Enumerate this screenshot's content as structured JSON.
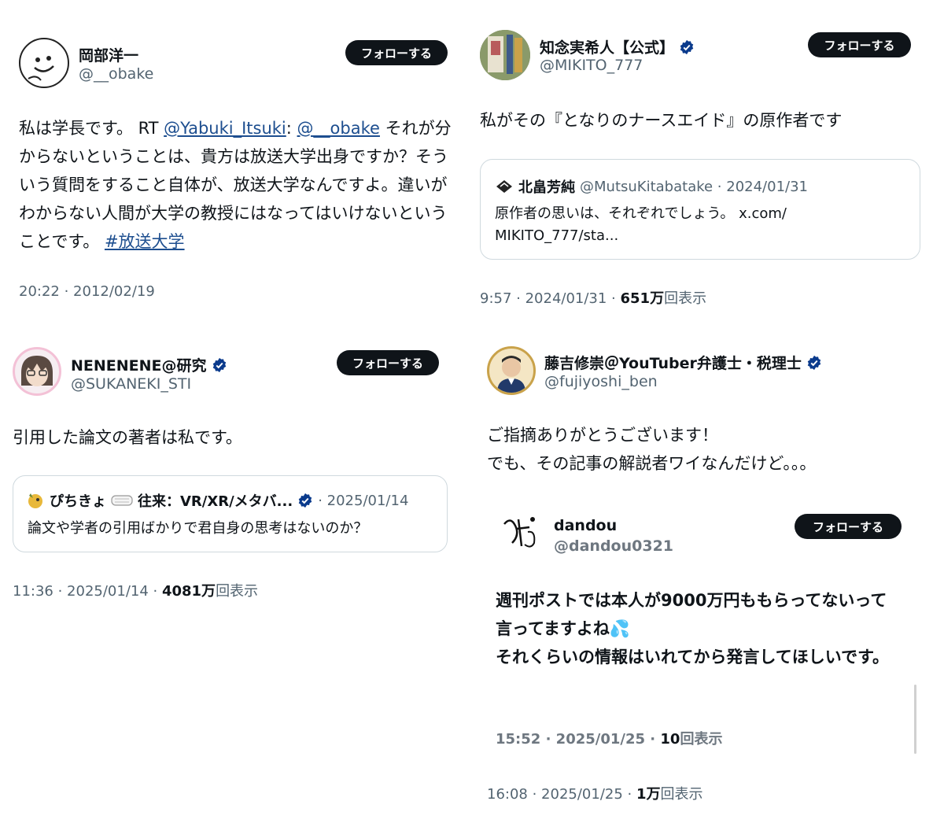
{
  "follow_label": "フォローする",
  "views_suffix": "回表示",
  "tweets": {
    "t1": {
      "name": "岡部洋一",
      "handle": "@__obake",
      "text_prefix": "私は学長です。 RT ",
      "mention1": "@Yabuki_Itsuki",
      "colon": ": ",
      "mention2": "@__obake",
      "text_main": " それが分からないということは、貴方は放送大学出身ですか？そういう質問をすること自体が、放送大学なんですよ。違いがわからない人間が大学の教授にはなってはいけないということです。 ",
      "hashtag": "#放送大学",
      "time": "20:22 · 2012/02/19"
    },
    "t2": {
      "name": "知念実希人【公式】",
      "handle": "@MIKITO_777",
      "text": "私がその『となりのナースエイド』の原作者です",
      "quote": {
        "name": "北畠芳純",
        "handle_date": "@MutsuKitabatake · 2024/01/31",
        "text": "原作者の思いは、それぞれでしょう。 x.com/\nMIKITO_777/sta..."
      },
      "time": "9:57 · 2024/01/31 · ",
      "views": "651万"
    },
    "t3": {
      "name": "NENENENE@研究",
      "handle": "@SUKANEKI_STI",
      "text": "引用した論文の著者は私です。",
      "quote": {
        "name": "ぴちきょ",
        "name2": "往来：VR/XR/メタバ...",
        "date": "· 2025/01/14",
        "text": "論文や学者の引用ばかりで君自身の思考はないのか？"
      },
      "time": "11:36 · 2025/01/14 · ",
      "views": "4081万"
    },
    "t4": {
      "name": "藤吉修崇＠YouTuber弁護士・税理士",
      "handle": "@fujiyoshi_ben",
      "text": "ご指摘ありがとうございます！\nでも、その記事の解説者ワイなんだけど。。。",
      "inner": {
        "name": "dandou",
        "handle": "@dandou0321",
        "text": "週刊ポストでは本人が9000万円ももらってないって言ってますよね💦\nそれくらいの情報はいれてから発言してほしいです。",
        "time": "15:52 · 2025/01/25 · ",
        "views": "10"
      },
      "time": "16:08 · 2025/01/25 · ",
      "views": "1万"
    }
  },
  "colors": {
    "verified": "#0a3a8c",
    "link": "#1d4e8f",
    "follow_bg": "#0f1419"
  }
}
